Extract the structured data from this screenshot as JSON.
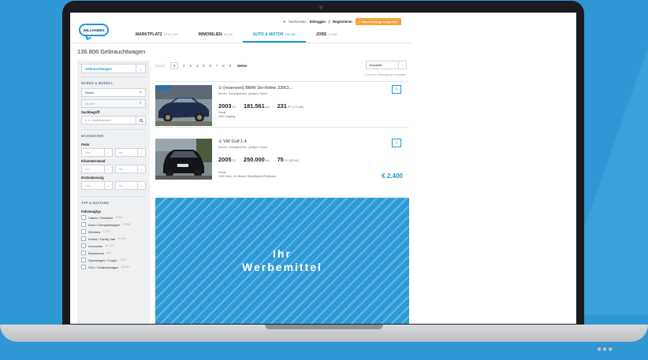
{
  "site": {
    "logo_text": "WILLHABEN",
    "top_links": {
      "messages": "Nachrichten",
      "login": "Einloggen",
      "separator": "|",
      "register": "Registrieren",
      "post_ad": "+ Neue Anzeige aufgeben"
    },
    "nav": [
      {
        "label": "MARKTPLATZ",
        "count": "10.613.297",
        "active": false
      },
      {
        "label": "IMMOBILIEN",
        "count": "98.753",
        "active": false
      },
      {
        "label": "AUTO & MOTOR",
        "count": "192.482",
        "active": true
      },
      {
        "label": "JOBS",
        "count": "21.084",
        "active": false
      }
    ],
    "results_heading": "136.806 Gebrauchtwagen"
  },
  "sidebar": {
    "category_select": "Gebrauchtwagen",
    "section_make": "MARKE & MODELL",
    "make_placeholder": "Marke",
    "model_placeholder": "Modell",
    "search_label": "Suchbegriff",
    "search_placeholder": "z. B. Modellvariante",
    "section_base": "BASISDATEN",
    "price_label": "Preis",
    "km_label": "Kilometerstand",
    "reg_label": "Erstzulassung",
    "from": "von",
    "to": "bis",
    "section_type": "TYP & ZUSTAND",
    "vehicle_type_label": "Fahrzeugtyp",
    "vehicle_types": [
      {
        "label": "Cabrio / Roadster",
        "count": "3.996"
      },
      {
        "label": "Klein-/ Kompaktwagen",
        "count": "12.838"
      },
      {
        "label": "Kleinbus",
        "count": "2.476"
      },
      {
        "label": "Kombi / Family Van",
        "count": "34.465"
      },
      {
        "label": "Limousine",
        "count": "18.703"
      },
      {
        "label": "Mopedauto",
        "count": "346"
      },
      {
        "label": "Sportwagen / Coupé",
        "count": "7.057"
      },
      {
        "label": "SUV / Geländewagen",
        "count": "36.690"
      }
    ]
  },
  "pager": {
    "prev": "Zurück",
    "pages": [
      "1",
      "2",
      "3",
      "4",
      "5",
      "6",
      "7",
      "8",
      "9"
    ],
    "next": "Weiter",
    "sort": "Aktualität",
    "info": "ⓘ Infos zur Reihung der Anzeigen"
  },
  "listings": [
    {
      "title": "⊙ (reserviert) BMW 3er-Reihe 330Ci...",
      "sub": "Benzin, Schaltgetriebe, gültiges Pickerl",
      "year": "2003",
      "year_unit": "EZ",
      "km": "181.561",
      "km_unit": "km",
      "ps": "231",
      "ps_unit": "PS (170 kW)",
      "seller": "Privat",
      "location": "2301 Seyring",
      "price": ""
    },
    {
      "title": "⊙ VW Golf 1.4",
      "sub": "Benzin, Schaltgetriebe, gültiges Pickerl",
      "year": "2005",
      "year_unit": "EZ",
      "km": "250.000",
      "km_unit": "km",
      "ps": "75",
      "ps_unit": "PS (55 kW)",
      "seller": "Privat",
      "location": "1150 Wien, 15. Bezirk, Rudolfsheim-Fünfhaus",
      "price": "€ 2.400"
    }
  ],
  "ad": {
    "line1": "Ihr",
    "line2": "Werbemittel"
  },
  "colors": {
    "brand_blue": "#1b9ad7",
    "orange": "#f6a43b",
    "background": "#2f97d3"
  }
}
